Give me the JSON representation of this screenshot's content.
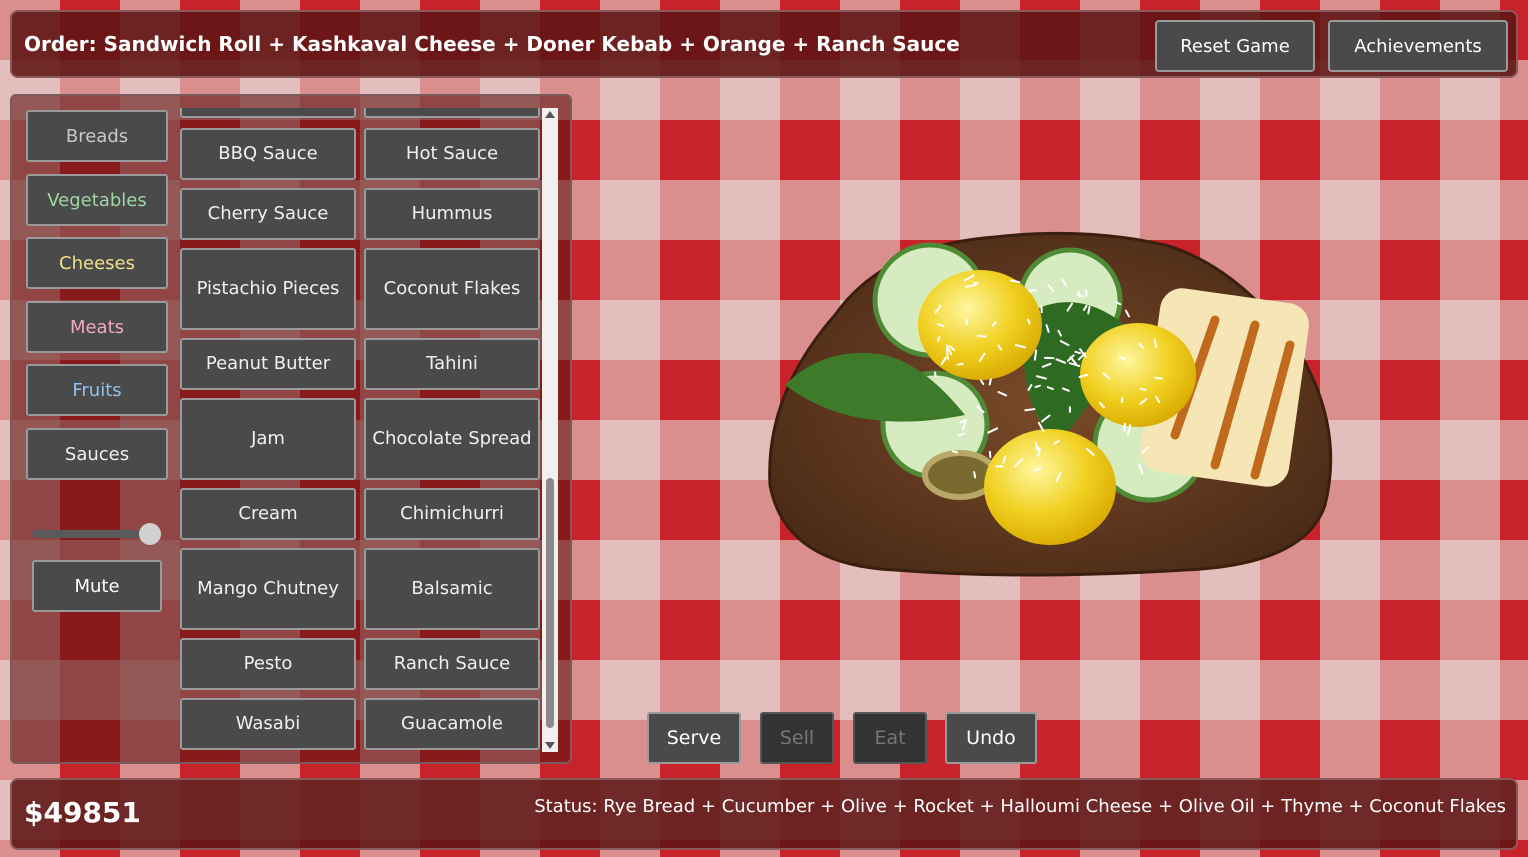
{
  "header": {
    "order": "Order: Sandwich Roll + Kashkaval Cheese + Doner Kebab + Orange + Ranch Sauce",
    "reset_label": "Reset Game",
    "achievements_label": "Achievements"
  },
  "categories": [
    {
      "label": "Breads",
      "color": "#c8c8c8"
    },
    {
      "label": "Vegetables",
      "color": "#9fd6a6"
    },
    {
      "label": "Cheeses",
      "color": "#f0e08a"
    },
    {
      "label": "Meats",
      "color": "#f2a7c4"
    },
    {
      "label": "Fruits",
      "color": "#8fc3f0"
    },
    {
      "label": "Sauces",
      "color": "#f0f0f0"
    }
  ],
  "volume": {
    "level": 1.0
  },
  "mute_label": "Mute",
  "ingredients": [
    "BBQ Sauce",
    "Hot Sauce",
    "Cherry Sauce",
    "Hummus",
    "Pistachio Pieces",
    "Coconut Flakes",
    "Peanut Butter",
    "Tahini",
    "Jam",
    "Chocolate Spread",
    "Cream",
    "Chimichurri",
    "Mango Chutney",
    "Balsamic",
    "Pesto",
    "Ranch Sauce",
    "Wasabi",
    "Guacamole"
  ],
  "actions": {
    "serve": "Serve",
    "sell": "Sell",
    "eat": "Eat",
    "undo": "Undo"
  },
  "footer": {
    "money": "$49851",
    "status": "Status: Rye Bread + Cucumber + Olive + Rocket + Halloumi Cheese + Olive Oil + Thyme + Coconut Flakes"
  }
}
